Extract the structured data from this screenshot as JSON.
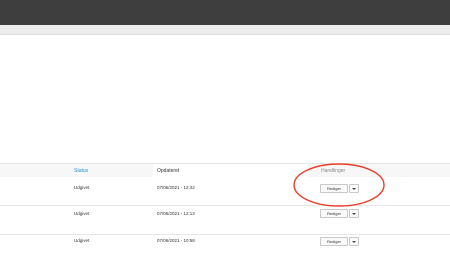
{
  "table": {
    "columns": {
      "status": "Status",
      "updated": "Opdateret",
      "actions": "Handlinger"
    },
    "rows": [
      {
        "status": "Udgivet",
        "updated": "07/06/2021 - 12:42",
        "action": "Rediger"
      },
      {
        "status": "Udgivet",
        "updated": "07/06/2021 - 12:13",
        "action": "Rediger"
      },
      {
        "status": "Udgivet",
        "updated": "07/06/2021 - 10:58",
        "action": "Rediger"
      }
    ]
  },
  "annotation_color": "#e8402a"
}
